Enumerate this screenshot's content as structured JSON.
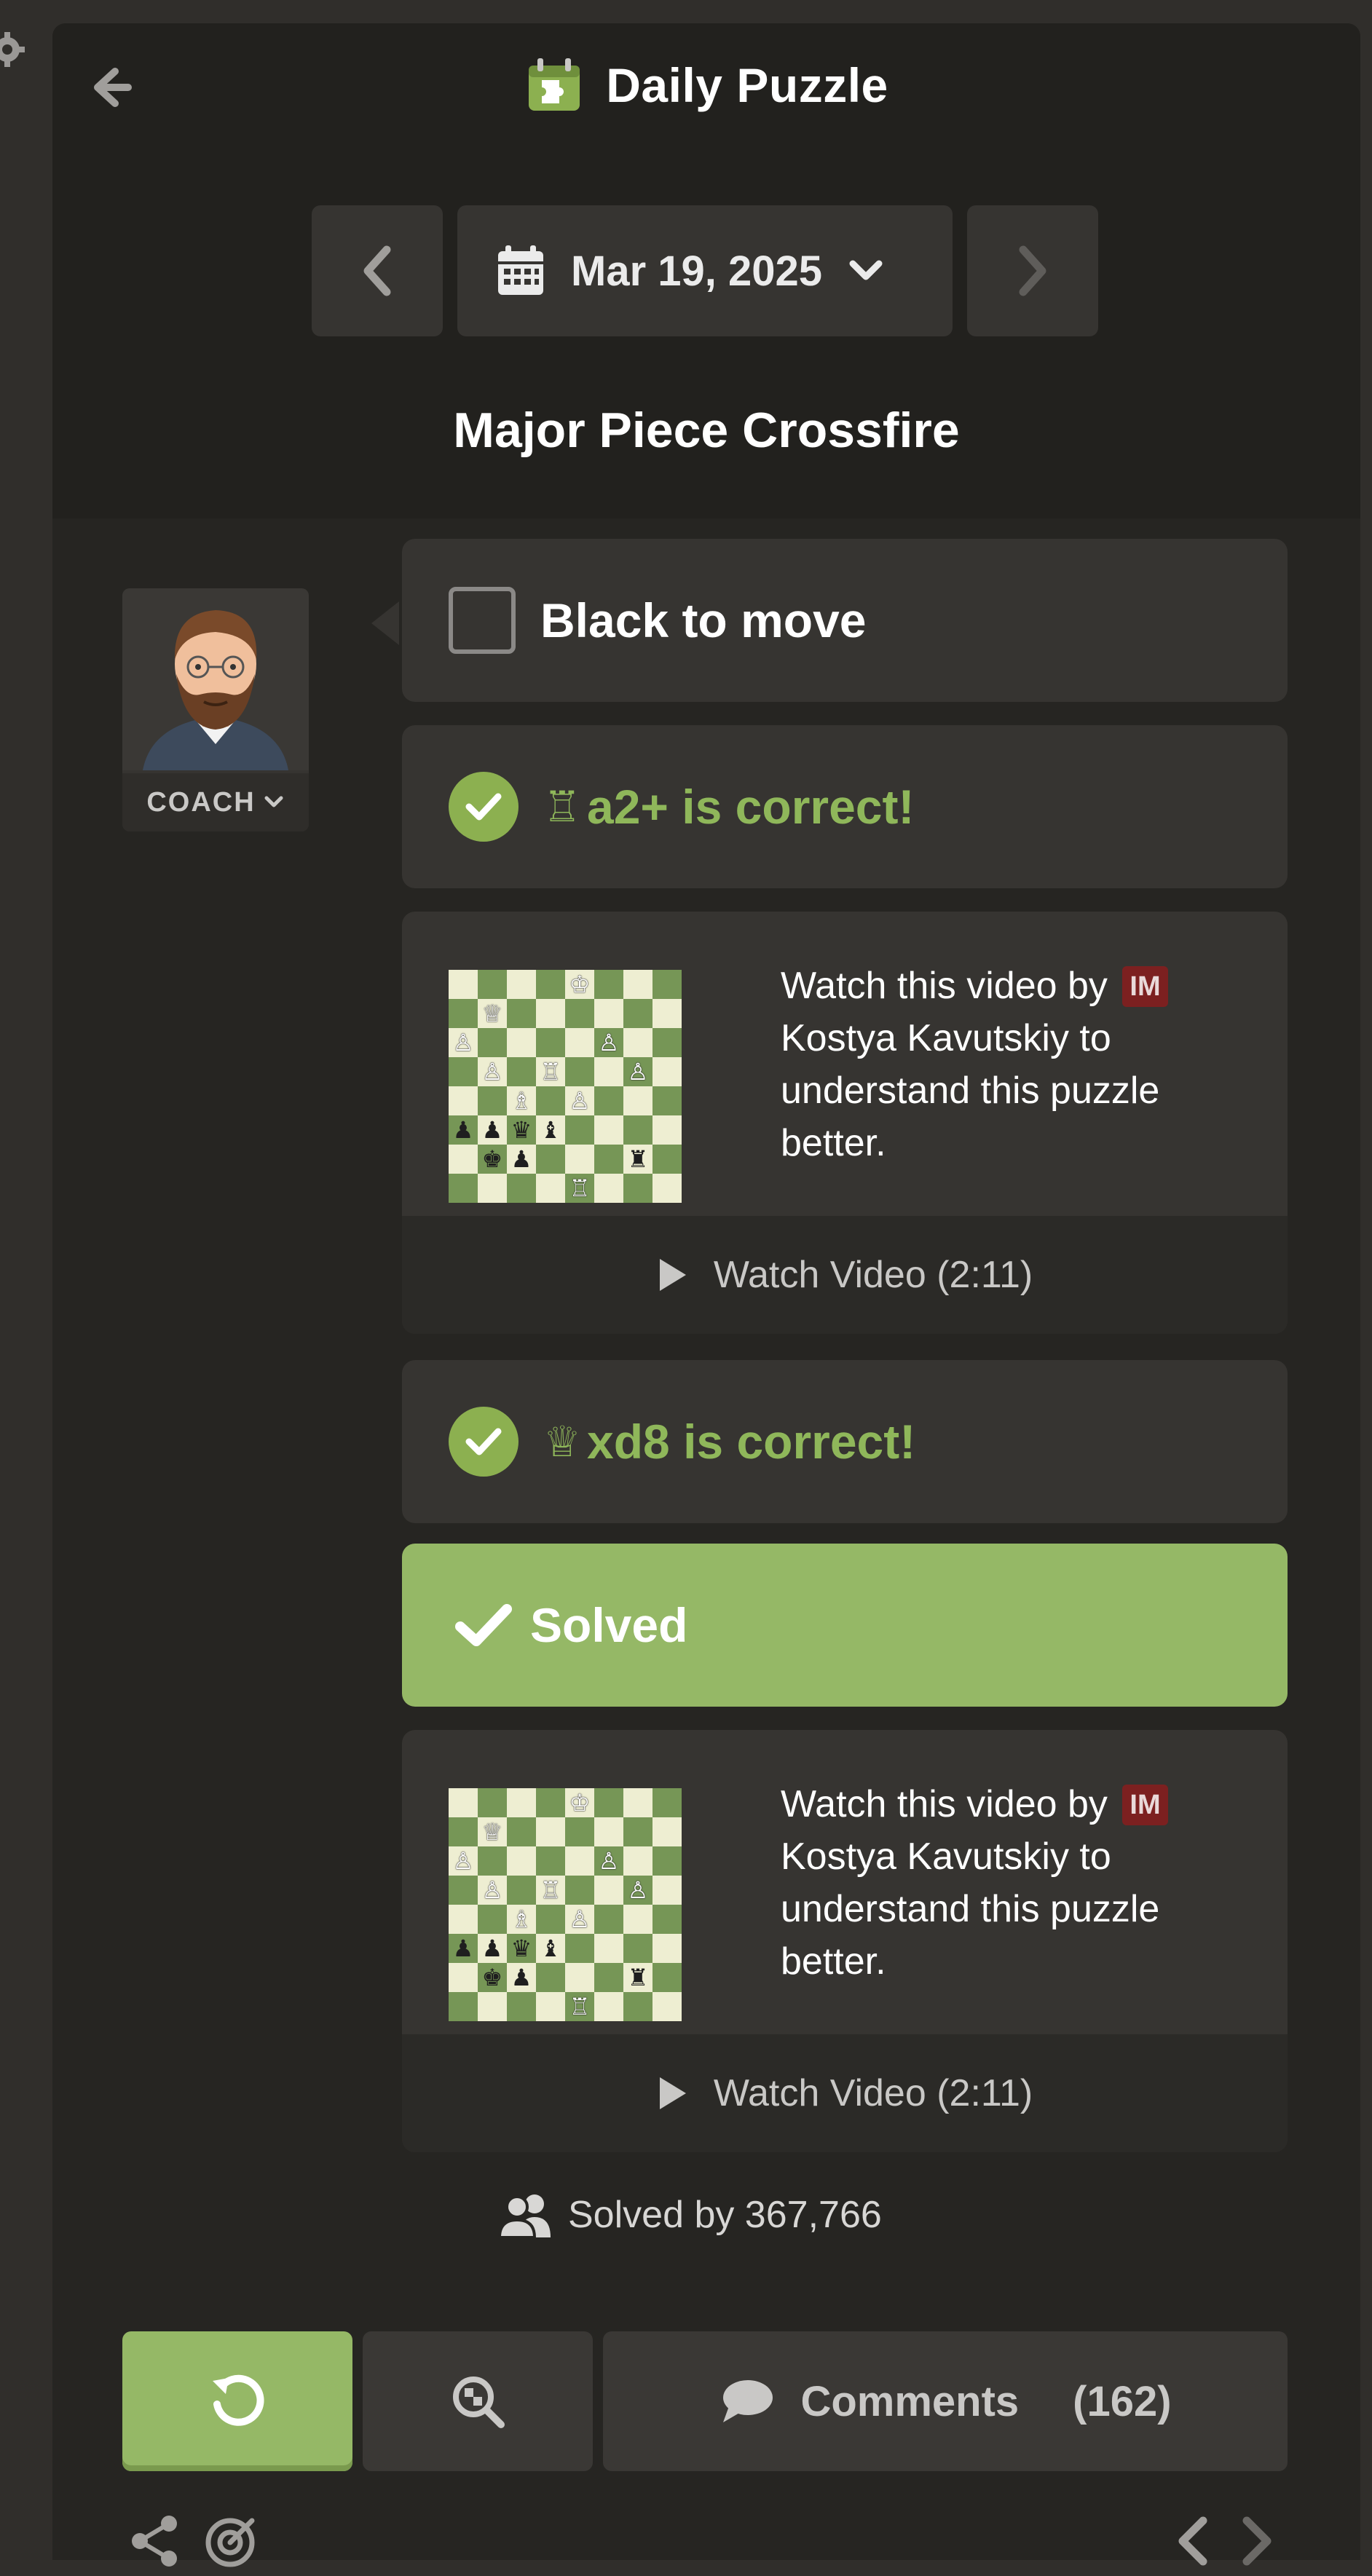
{
  "header": {
    "title": "Daily Puzzle",
    "date": "Mar 19, 2025",
    "puzzle_name": "Major Piece Crossfire"
  },
  "coach": {
    "label": "COACH"
  },
  "moves": {
    "prompt": "Black to move",
    "correct_1_piece": "♖",
    "correct_1_text": "a2+ is correct!",
    "correct_2_piece": "♕",
    "correct_2_text": "xd8 is correct!",
    "solved_label": "Solved"
  },
  "video": {
    "desc_prefix": "Watch this video by",
    "title_badge": "IM",
    "desc_suffix": "Kostya Kavutskiy to understand this puzzle better.",
    "watch_label": "Watch Video (2:11)"
  },
  "stats": {
    "solved_by": "Solved by 367,766"
  },
  "actions": {
    "comments_label": "Comments",
    "comments_count": "(162)"
  },
  "colors": {
    "accent_green": "#95b866",
    "correct_green": "#8fb75a",
    "im_badge": "#7c2020",
    "board_light": "#eeeed2",
    "board_dark": "#769656"
  },
  "icons": [
    "settings-gear-icon",
    "back-arrow-icon",
    "daily-puzzle-icon",
    "calendar-icon",
    "chevron-down-icon",
    "chevron-left-icon",
    "chevron-right-icon",
    "checkmark-icon",
    "play-icon",
    "users-icon",
    "retry-icon",
    "analysis-icon",
    "comment-icon",
    "share-icon",
    "target-icon"
  ],
  "board": {
    "rows": [
      [
        " ",
        " ",
        " ",
        " ",
        "K",
        " ",
        " ",
        " "
      ],
      [
        " ",
        "Q",
        " ",
        " ",
        " ",
        " ",
        " ",
        " "
      ],
      [
        "P",
        " ",
        " ",
        " ",
        " ",
        "P",
        " ",
        " "
      ],
      [
        " ",
        "P",
        " ",
        "R",
        " ",
        " ",
        "P",
        " "
      ],
      [
        " ",
        " ",
        "B",
        " ",
        "P",
        " ",
        " ",
        " "
      ],
      [
        "p",
        "p",
        "q",
        "b",
        " ",
        " ",
        " ",
        " "
      ],
      [
        " ",
        "k",
        "p",
        " ",
        " ",
        " ",
        "r",
        " "
      ],
      [
        " ",
        " ",
        " ",
        " ",
        "R",
        " ",
        " ",
        " "
      ]
    ]
  }
}
